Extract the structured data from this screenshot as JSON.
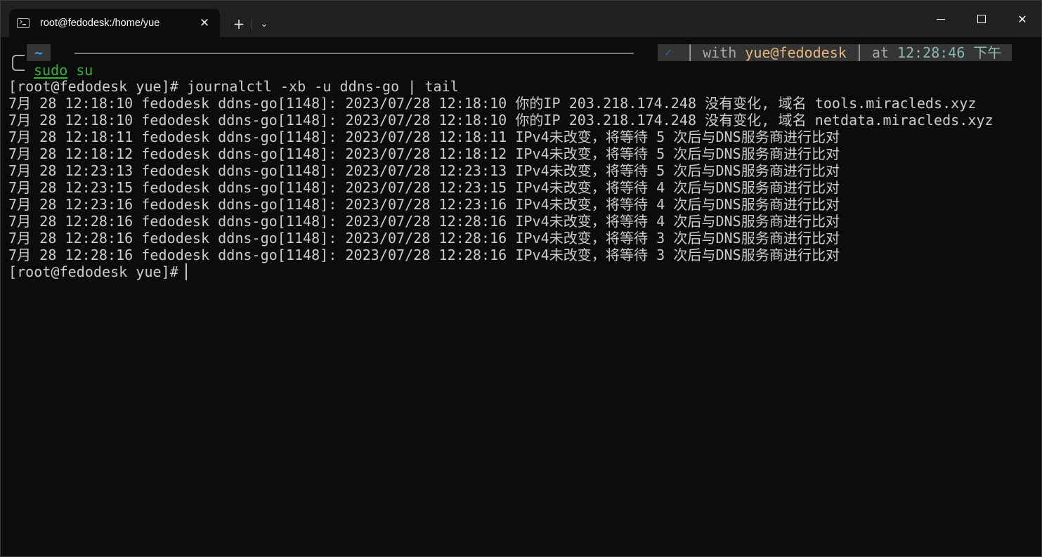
{
  "window": {
    "tab_title": "root@fedodesk:/home/yue",
    "tab_close": "✕",
    "new_tab": "+",
    "dropdown": "⌄",
    "minimize": "─",
    "maximize": "□",
    "close": "✕"
  },
  "prompt": {
    "dir": "~",
    "status_check": "✓",
    "status_with": "│ with ",
    "status_user": "yue@fedodesk",
    "status_at": " │ at ",
    "status_time": "12:28:46 下午",
    "sudo_cmd": "sudo",
    "sudo_arg": " su"
  },
  "terminal": {
    "command_line": "[root@fedodesk yue]# journalctl -xb -u ddns-go | tail",
    "log_lines": [
      "7月 28 12:18:10 fedodesk ddns-go[1148]: 2023/07/28 12:18:10 你的IP 203.218.174.248 没有变化, 域名 tools.miracleds.xyz",
      "7月 28 12:18:10 fedodesk ddns-go[1148]: 2023/07/28 12:18:10 你的IP 203.218.174.248 没有变化, 域名 netdata.miracleds.xyz",
      "7月 28 12:18:11 fedodesk ddns-go[1148]: 2023/07/28 12:18:11 IPv4未改变，将等待 5 次后与DNS服务商进行比对",
      "7月 28 12:18:12 fedodesk ddns-go[1148]: 2023/07/28 12:18:12 IPv4未改变，将等待 5 次后与DNS服务商进行比对",
      "7月 28 12:23:13 fedodesk ddns-go[1148]: 2023/07/28 12:23:13 IPv4未改变，将等待 5 次后与DNS服务商进行比对",
      "7月 28 12:23:15 fedodesk ddns-go[1148]: 2023/07/28 12:23:15 IPv4未改变，将等待 4 次后与DNS服务商进行比对",
      "7月 28 12:23:16 fedodesk ddns-go[1148]: 2023/07/28 12:23:16 IPv4未改变，将等待 4 次后与DNS服务商进行比对",
      "7月 28 12:28:16 fedodesk ddns-go[1148]: 2023/07/28 12:28:16 IPv4未改变，将等待 4 次后与DNS服务商进行比对",
      "7月 28 12:28:16 fedodesk ddns-go[1148]: 2023/07/28 12:28:16 IPv4未改变，将等待 3 次后与DNS服务商进行比对",
      "7月 28 12:28:16 fedodesk ddns-go[1148]: 2023/07/28 12:28:16 IPv4未改变，将等待 3 次后与DNS服务商进行比对"
    ],
    "final_prompt": "[root@fedodesk yue]# "
  },
  "colors": {
    "background": "#0c0c0c",
    "titlebar": "#202020",
    "foreground": "#cccccc",
    "dir_blue": "#3b9ae8",
    "sudo_green": "#36b336",
    "user_tan": "#e5b880",
    "time_teal": "#8ab8b0"
  },
  "icons": {
    "tab_icon": "terminal-icon"
  }
}
